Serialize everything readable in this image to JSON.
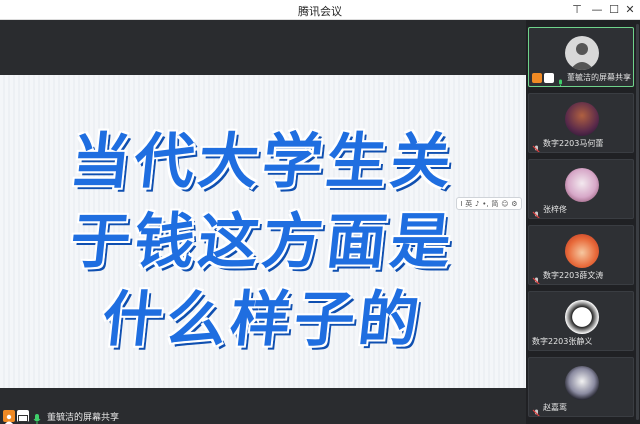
{
  "window": {
    "title": "腾讯会议"
  },
  "slide": {
    "lines": [
      "当代大学生关",
      "于钱这方面是",
      "什么样子的"
    ],
    "accent_color": "#1f6ee0"
  },
  "float_toolbar": {
    "items": [
      "I",
      "英",
      "♪",
      "•,",
      "简",
      "☺",
      "⚙"
    ]
  },
  "share_bar": {
    "label": "董毓洁的屏幕共享"
  },
  "participants": [
    {
      "name": "董毓洁的屏幕共享",
      "active": true,
      "icon": "default-avatar-icon"
    },
    {
      "name": "数字2203马何蕾",
      "active": false,
      "icon": "anime-avatar-icon"
    },
    {
      "name": "张梓佟",
      "active": false,
      "icon": "anime-avatar-icon"
    },
    {
      "name": "数字2203薛文涛",
      "active": false,
      "icon": "cartoon-avatar-icon"
    },
    {
      "name": "数字2203张静义",
      "active": false,
      "icon": "cartoon-avatar-icon"
    },
    {
      "name": "赵嘉鸾",
      "active": false,
      "icon": "anime-avatar-icon"
    }
  ]
}
